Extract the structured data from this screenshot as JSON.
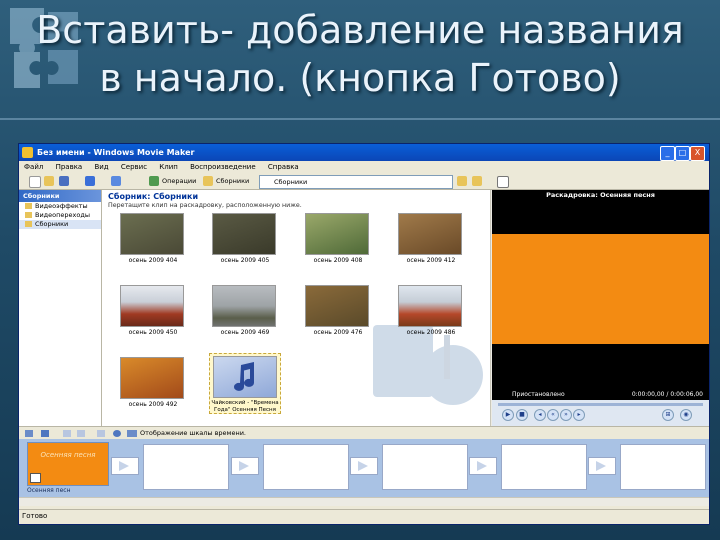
{
  "slide": {
    "title_line1": "Вставить- добавление названия",
    "title_line2": "в начало. (кнопка Готово)"
  },
  "window": {
    "title": "Без имени - Windows Movie Maker",
    "controls": [
      "_",
      "□",
      "X"
    ]
  },
  "menu": [
    "Файл",
    "Правка",
    "Вид",
    "Сервис",
    "Клип",
    "Воспроизведение",
    "Справка"
  ],
  "toolbar": {
    "tasks_label": "Операции",
    "collections_label": "Сборники",
    "combo_value": "Сборники"
  },
  "left_pane": {
    "header": "Сборники",
    "items": [
      "Видеоэффекты",
      "Видеопереходы",
      "Сборники"
    ]
  },
  "collection": {
    "heading": "Сборник: Сборники",
    "hint": "Перетащите клип на раскадровку, расположенную ниже.",
    "clips": [
      {
        "label": "осень 2009 404",
        "color": "#5b6046"
      },
      {
        "label": "осень 2009 405",
        "color": "#4b4a36"
      },
      {
        "label": "осень 2009 408",
        "color": "#6f7f4b"
      },
      {
        "label": "осень 2009 412",
        "color": "#8a6a3b"
      },
      {
        "label": "осень 2009 450",
        "color": "#8a3a22"
      },
      {
        "label": "осень 2009 469",
        "color": "#8a8f8c"
      },
      {
        "label": "осень 2009 476",
        "color": "#7a5a2e"
      },
      {
        "label": "осень 2009 486",
        "color": "#a24a2a"
      },
      {
        "label": "осень 2009 492",
        "color": "#c46a1e"
      },
      {
        "label": "Чайковский - \"Времена Года\" Осенняя Песня",
        "color": "#8fa8d8"
      }
    ]
  },
  "preview": {
    "title": "Раскадровка: Осенняя песня",
    "status": "Приостановлено",
    "time": "0:00:00,00 / 0:00:06,00",
    "screen_color": "#f38b12"
  },
  "storyboard": {
    "toolbar_label": "Отображение шкалы времени.",
    "first_frame_text": "Осенняя песня",
    "first_frame_label": "Осенняя песн"
  },
  "statusbar": {
    "text": "Готово"
  }
}
